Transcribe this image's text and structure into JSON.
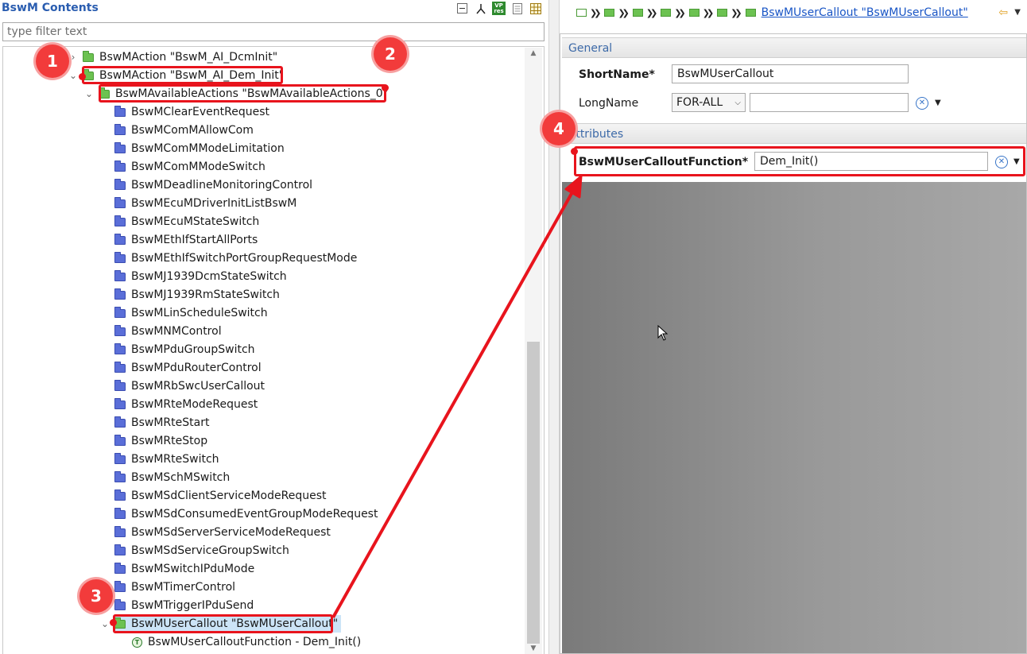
{
  "left_panel": {
    "title": "BswM Contents",
    "filter_placeholder": "type filter text",
    "toolbar_vp_line1": "VP",
    "toolbar_vp_line2": "res"
  },
  "tree": {
    "items": [
      {
        "label": "BswMAction \"BswM_AI_DcmInit\"",
        "icon": "green-folder",
        "twisty": "collapsed"
      },
      {
        "label": "BswMAction \"BswM_AI_Dem_Init\"",
        "icon": "green-folder",
        "twisty": "expanded"
      },
      {
        "label": "BswMAvailableActions \"BswMAvailableActions_0\"",
        "icon": "green-folder",
        "twisty": "expanded"
      },
      {
        "label": "BswMClearEventRequest",
        "icon": "blue-folder"
      },
      {
        "label": "BswMComMAllowCom",
        "icon": "blue-folder"
      },
      {
        "label": "BswMComMModeLimitation",
        "icon": "blue-folder"
      },
      {
        "label": "BswMComMModeSwitch",
        "icon": "blue-folder"
      },
      {
        "label": "BswMDeadlineMonitoringControl",
        "icon": "blue-folder"
      },
      {
        "label": "BswMEcuMDriverInitListBswM",
        "icon": "blue-folder"
      },
      {
        "label": "BswMEcuMStateSwitch",
        "icon": "blue-folder"
      },
      {
        "label": "BswMEthIfStartAllPorts",
        "icon": "blue-folder"
      },
      {
        "label": "BswMEthIfSwitchPortGroupRequestMode",
        "icon": "blue-folder"
      },
      {
        "label": "BswMJ1939DcmStateSwitch",
        "icon": "blue-folder"
      },
      {
        "label": "BswMJ1939RmStateSwitch",
        "icon": "blue-folder"
      },
      {
        "label": "BswMLinScheduleSwitch",
        "icon": "blue-folder"
      },
      {
        "label": "BswMNMControl",
        "icon": "blue-folder"
      },
      {
        "label": "BswMPduGroupSwitch",
        "icon": "blue-folder"
      },
      {
        "label": "BswMPduRouterControl",
        "icon": "blue-folder"
      },
      {
        "label": "BswMRbSwcUserCallout",
        "icon": "blue-folder"
      },
      {
        "label": "BswMRteModeRequest",
        "icon": "blue-folder"
      },
      {
        "label": "BswMRteStart",
        "icon": "blue-folder"
      },
      {
        "label": "BswMRteStop",
        "icon": "blue-folder"
      },
      {
        "label": "BswMRteSwitch",
        "icon": "blue-folder"
      },
      {
        "label": "BswMSchMSwitch",
        "icon": "blue-folder"
      },
      {
        "label": "BswMSdClientServiceModeRequest",
        "icon": "blue-folder"
      },
      {
        "label": "BswMSdConsumedEventGroupModeRequest",
        "icon": "blue-folder"
      },
      {
        "label": "BswMSdServerServiceModeRequest",
        "icon": "blue-folder"
      },
      {
        "label": "BswMSdServiceGroupSwitch",
        "icon": "blue-folder"
      },
      {
        "label": "BswMSwitchIPduMode",
        "icon": "blue-folder"
      },
      {
        "label": "BswMTimerControl",
        "icon": "blue-folder"
      },
      {
        "label": "BswMTriggerIPduSend",
        "icon": "blue-folder"
      },
      {
        "label": "BswMUserCallout \"BswMUserCallout\"",
        "icon": "green-folder",
        "twisty": "expanded",
        "selected": true
      },
      {
        "label": "BswMUserCalloutFunction - Dem_Init()",
        "icon": "parameter-icon"
      }
    ]
  },
  "editor": {
    "breadcrumb_link": "BswMUserCallout \"BswMUserCallout\"",
    "general_section": "General",
    "shortname_label": "ShortName*",
    "shortname_value": "BswMUserCallout",
    "longname_label": "LongName",
    "longname_lang": "FOR-ALL",
    "longname_value": "",
    "attributes_section": "Attributes",
    "callout_label": "BswMUserCalloutFunction*",
    "callout_value": "Dem_Init()"
  },
  "annotations": {
    "badge1": "1",
    "badge2": "2",
    "badge3": "3",
    "badge4": "4",
    "color": "#e8141d"
  }
}
